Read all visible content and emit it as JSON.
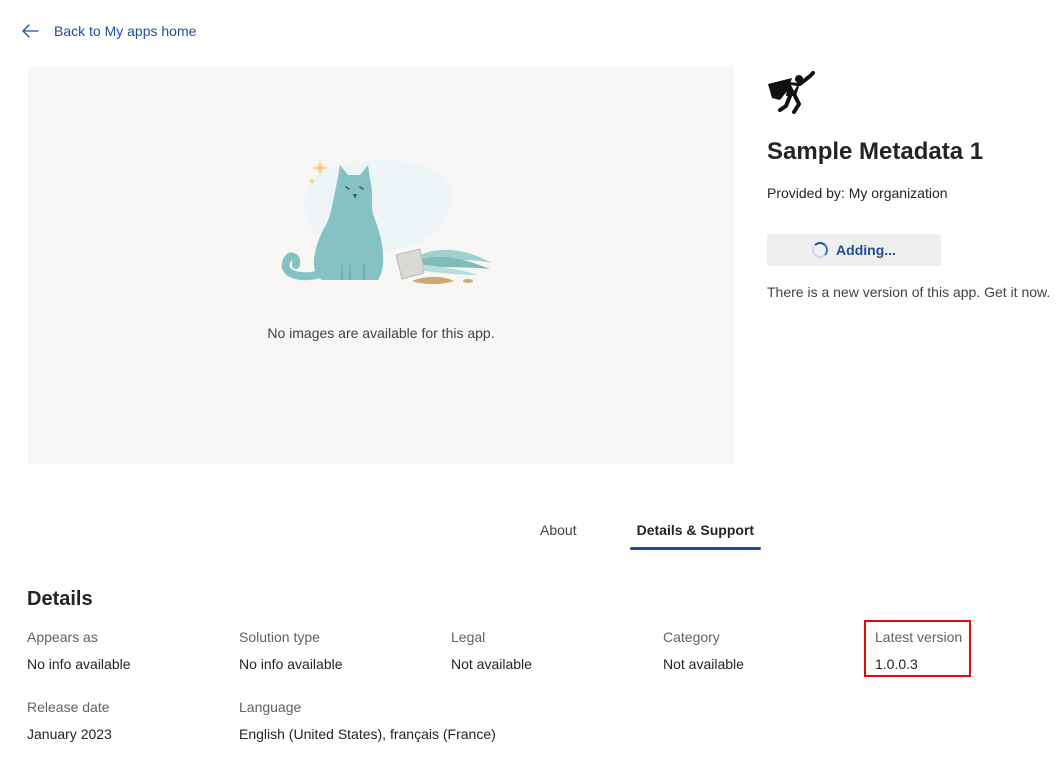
{
  "back_link": {
    "label": "Back to My apps home",
    "icon": "arrow-left-icon"
  },
  "preview": {
    "empty_message": "No images are available for this app.",
    "illustration": "cat-with-knocked-over-plant"
  },
  "app": {
    "icon": "superhero-icon",
    "title": "Sample Metadata 1",
    "provider": "Provided by: My organization",
    "add_button_label": "Adding...",
    "new_version_notice": "There is a new version of this app. Get it now."
  },
  "tabs": [
    {
      "label": "About",
      "active": false
    },
    {
      "label": "Details & Support",
      "active": true
    }
  ],
  "details": {
    "heading": "Details",
    "fields": [
      {
        "label": "Appears as",
        "value": "No info available"
      },
      {
        "label": "Solution type",
        "value": "No info available"
      },
      {
        "label": "Legal",
        "value": "Not available"
      },
      {
        "label": "Category",
        "value": "Not available"
      },
      {
        "label": "Latest version",
        "value": "1.0.0.3",
        "highlighted": true
      },
      {
        "label": "Release date",
        "value": "January 2023"
      },
      {
        "label": "Language",
        "value": "English (United States), français (France)"
      }
    ]
  },
  "colors": {
    "accent": "#1f4e98",
    "highlight_border": "#e00b0b",
    "preview_background": "#f8f7f5",
    "button_background": "#efefef"
  }
}
